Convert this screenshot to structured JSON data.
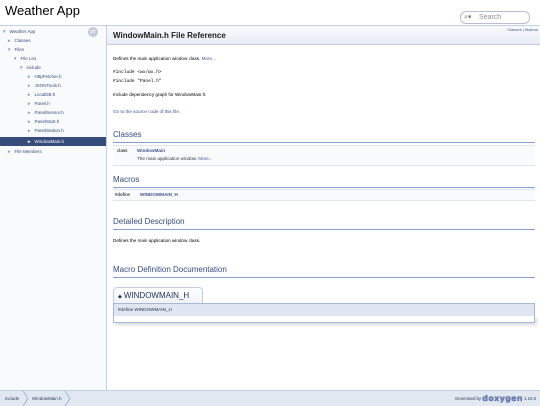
{
  "app": {
    "title": "Weather App"
  },
  "search": {
    "placeholder": "Search"
  },
  "sidebar": {
    "items": [
      {
        "label": "Weather App",
        "arrow": "▼"
      },
      {
        "label": "Classes",
        "arrow": "►"
      },
      {
        "label": "Files",
        "arrow": "▼"
      },
      {
        "label": "File List",
        "arrow": "▼"
      },
      {
        "label": "include",
        "arrow": "▼"
      },
      {
        "label": "HttpFetcher.h",
        "arrow": "►"
      },
      {
        "label": "JSONTools.h",
        "arrow": "►"
      },
      {
        "label": "LocalDB.h",
        "arrow": "►"
      },
      {
        "label": "Panel.h",
        "arrow": "►"
      },
      {
        "label": "PanelSensor.h",
        "arrow": "►"
      },
      {
        "label": "PanelStart.h",
        "arrow": "►"
      },
      {
        "label": "PanelStation.h",
        "arrow": "►"
      },
      {
        "label": "WindowMain.h",
        "arrow": "►"
      },
      {
        "label": "File Members",
        "arrow": "►"
      }
    ]
  },
  "header": {
    "title": "WindowMain.h File Reference",
    "summary_classes": "Classes",
    "summary_sep": " | ",
    "summary_macros": "Macros"
  },
  "intro": {
    "text": "Defines the main application window class.",
    "more": "More...",
    "include1": "#include <wx/wx.h>",
    "include2": "#include \"Panel.h\"",
    "graph": "Include dependency graph for WindowMain.h:",
    "source_link": "Go to the source code of this file."
  },
  "classes": {
    "title": "Classes",
    "kind": "class",
    "name": "WindowMain",
    "desc": "The main application window.",
    "more": "More..."
  },
  "macros": {
    "title": "Macros",
    "kind": "#define",
    "name": "WINDOWMAIN_H"
  },
  "detailed": {
    "title": "Detailed Description",
    "text": "Defines the main application window class."
  },
  "macro_doc": {
    "title": "Macro Definition Documentation",
    "name": "WINDOWMAIN_H",
    "diamond": "◆",
    "proto": "#define WINDOWMAIN_H"
  },
  "footer": {
    "crumbs": [
      "include",
      "WindowMain.h"
    ],
    "generated": "Generated by",
    "logo": "doxygen",
    "version": "1.10.0"
  }
}
